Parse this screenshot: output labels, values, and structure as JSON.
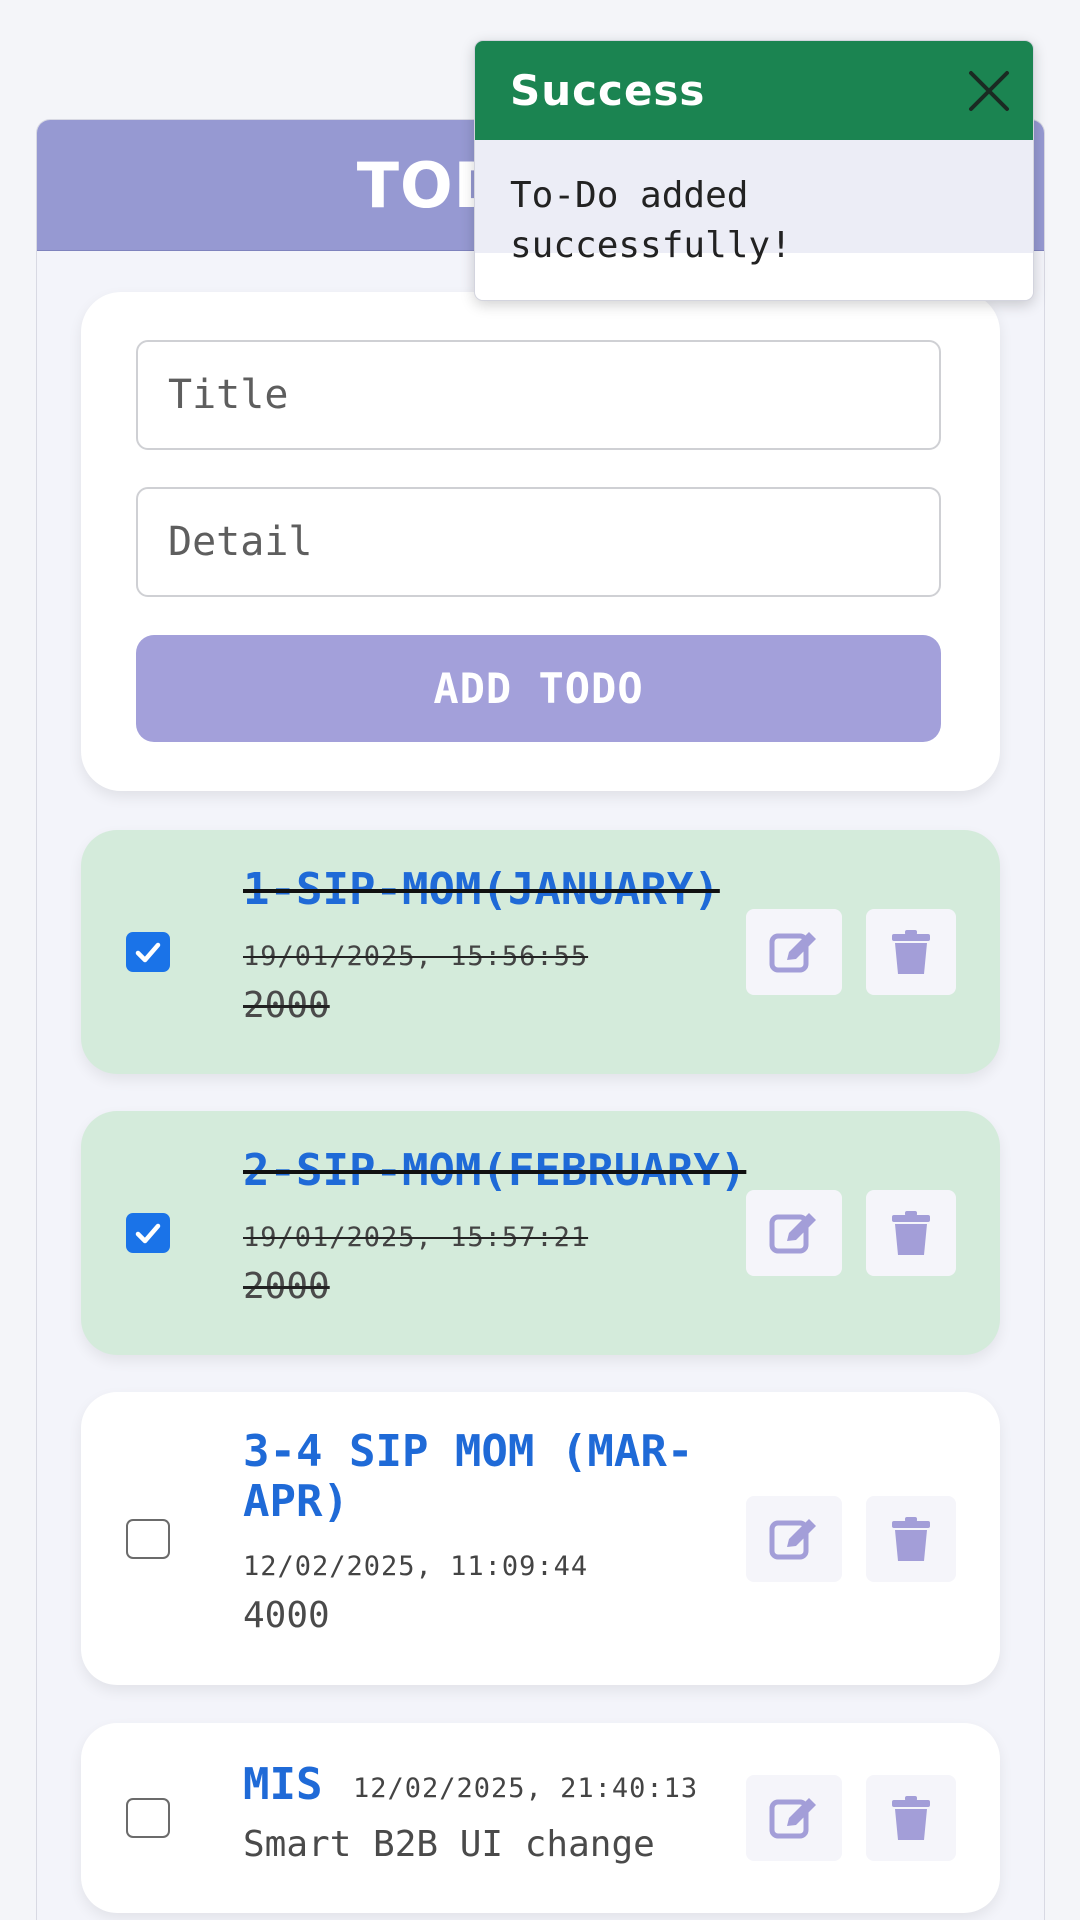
{
  "header": {
    "title": "TODO APP"
  },
  "form": {
    "title_placeholder": "Title",
    "detail_placeholder": "Detail",
    "add_label": "ADD TODO"
  },
  "todos": [
    {
      "title": "1-SIP-MOM(JANUARY)",
      "date": "19/01/2025, 15:56:55",
      "detail": "2000",
      "done": true
    },
    {
      "title": "2-SIP-MOM(FEBRUARY)",
      "date": "19/01/2025, 15:57:21",
      "detail": "2000",
      "done": true
    },
    {
      "title": "3-4 SIP MOM (MAR-APR)",
      "date": "12/02/2025, 11:09:44",
      "detail": "4000",
      "done": false
    },
    {
      "title": "MIS",
      "date": "12/02/2025, 21:40:13",
      "detail": "Smart B2B UI change",
      "done": false
    }
  ],
  "toast": {
    "title": "Success",
    "message": "To-Do added successfully!"
  },
  "colors": {
    "header": "#9699d2",
    "button": "#a3a0da",
    "done_bg": "#d4ebdb",
    "title_blue": "#1f6ad7",
    "toast_green": "#1b8451",
    "icon": "#a39ed8"
  },
  "icons": [
    "edit-icon",
    "trash-icon",
    "checkmark-icon",
    "close-icon"
  ]
}
